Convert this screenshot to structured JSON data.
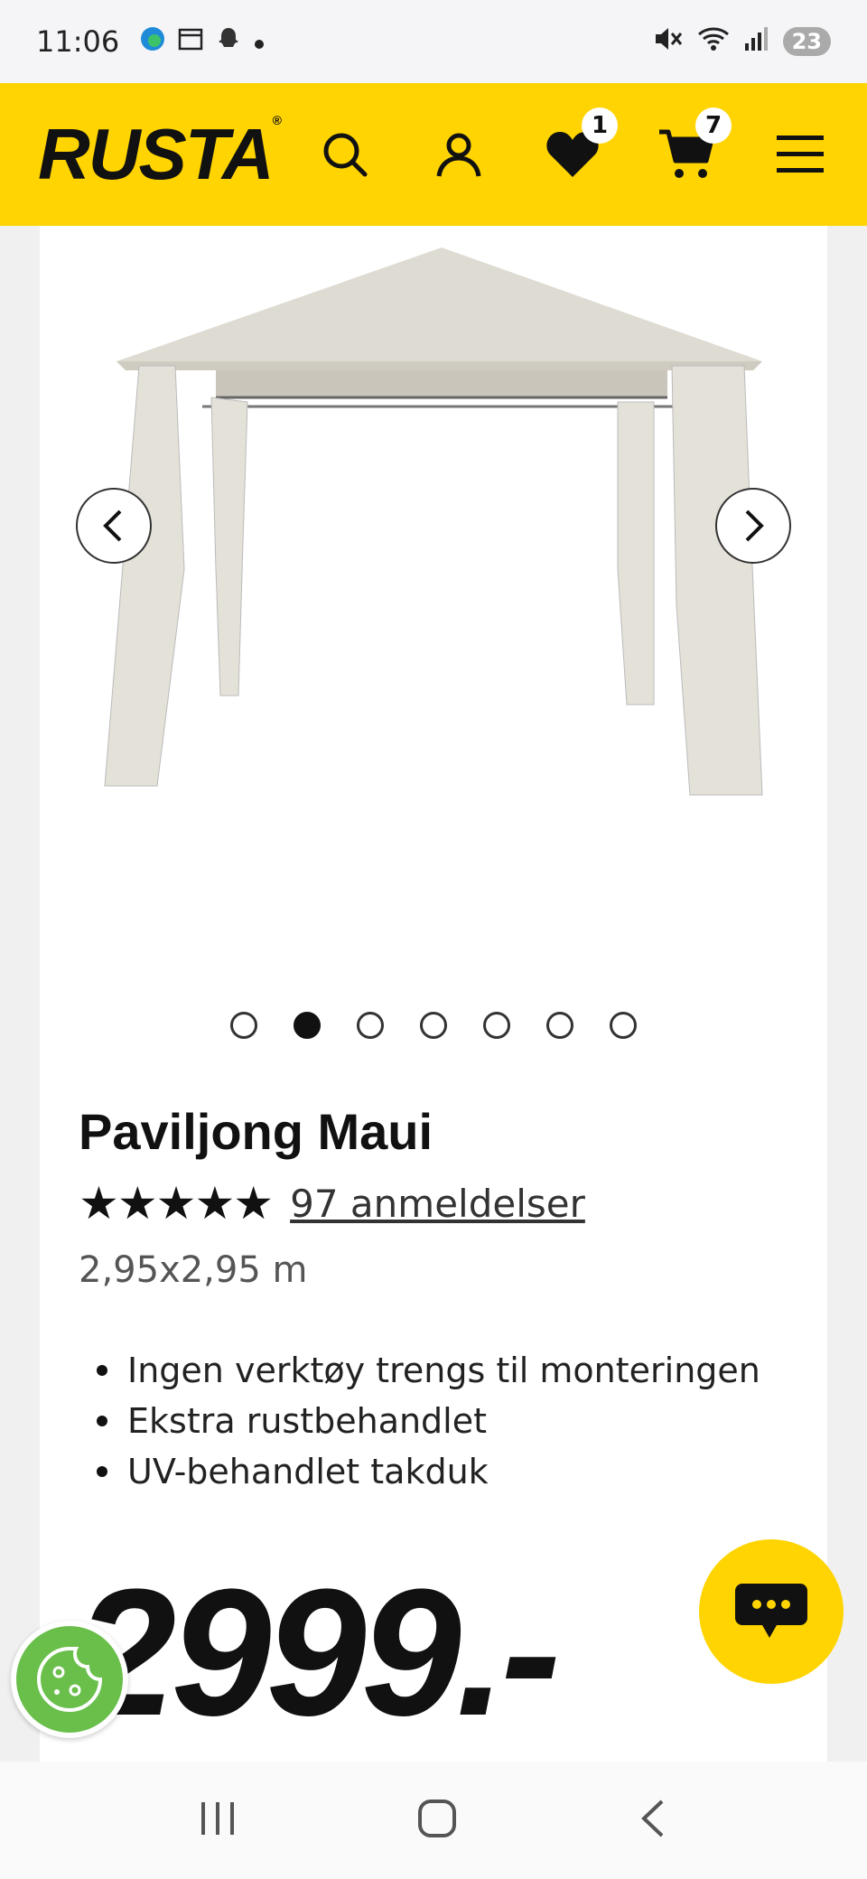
{
  "status_bar": {
    "time": "11:06",
    "battery": "23",
    "left_icons": [
      "edge-icon",
      "calendar-icon",
      "snapchat-icon",
      "dot-icon"
    ],
    "right_icons": [
      "mute-icon",
      "wifi-icon",
      "signal-icon"
    ]
  },
  "header": {
    "logo": "RUSTA",
    "wishlist_count": "1",
    "cart_count": "7",
    "background": "#ffd400"
  },
  "gallery": {
    "slides": 7,
    "active_slide": 2
  },
  "product": {
    "title": "Paviljong Maui",
    "stars": "★★★★★",
    "rating": 5,
    "reviews": "97 anmeldelser",
    "size": "2,95x2,95 m",
    "features": [
      "Ingen verktøy trengs til monteringen",
      "Ekstra rustbehandlet",
      "UV-behandlet takduk"
    ],
    "price": "2999.-"
  }
}
